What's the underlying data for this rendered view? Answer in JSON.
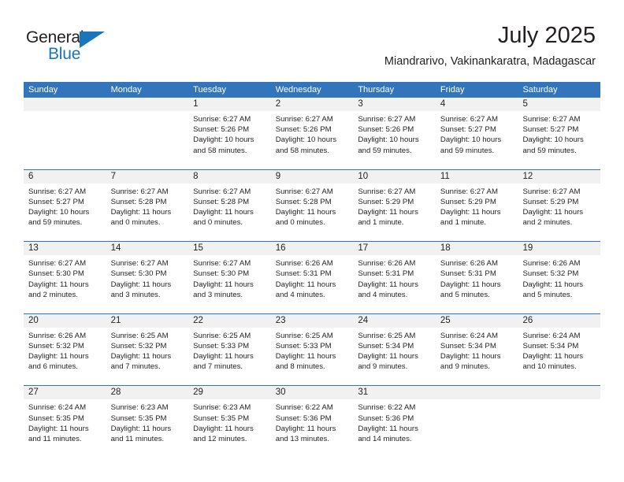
{
  "brand": {
    "name_top": "General",
    "name_bottom": "Blue",
    "color_blue": "#1b75bb",
    "color_dark": "#231f20"
  },
  "header": {
    "title": "July 2025",
    "subtitle": "Miandrarivo, Vakinankaratra, Madagascar"
  },
  "theme": {
    "header_blue": "#3275bc",
    "band_gray": "#f1f1f1",
    "text": "#231f20"
  },
  "weekdays": [
    "Sunday",
    "Monday",
    "Tuesday",
    "Wednesday",
    "Thursday",
    "Friday",
    "Saturday"
  ],
  "weeks": [
    [
      {
        "day": "",
        "sunrise": "",
        "sunset": "",
        "daylight1": "",
        "daylight2": "",
        "empty": true
      },
      {
        "day": "",
        "sunrise": "",
        "sunset": "",
        "daylight1": "",
        "daylight2": "",
        "empty": true
      },
      {
        "day": "1",
        "sunrise": "Sunrise: 6:27 AM",
        "sunset": "Sunset: 5:26 PM",
        "daylight1": "Daylight: 10 hours",
        "daylight2": "and 58 minutes."
      },
      {
        "day": "2",
        "sunrise": "Sunrise: 6:27 AM",
        "sunset": "Sunset: 5:26 PM",
        "daylight1": "Daylight: 10 hours",
        "daylight2": "and 58 minutes."
      },
      {
        "day": "3",
        "sunrise": "Sunrise: 6:27 AM",
        "sunset": "Sunset: 5:26 PM",
        "daylight1": "Daylight: 10 hours",
        "daylight2": "and 59 minutes."
      },
      {
        "day": "4",
        "sunrise": "Sunrise: 6:27 AM",
        "sunset": "Sunset: 5:27 PM",
        "daylight1": "Daylight: 10 hours",
        "daylight2": "and 59 minutes."
      },
      {
        "day": "5",
        "sunrise": "Sunrise: 6:27 AM",
        "sunset": "Sunset: 5:27 PM",
        "daylight1": "Daylight: 10 hours",
        "daylight2": "and 59 minutes."
      }
    ],
    [
      {
        "day": "6",
        "sunrise": "Sunrise: 6:27 AM",
        "sunset": "Sunset: 5:27 PM",
        "daylight1": "Daylight: 10 hours",
        "daylight2": "and 59 minutes."
      },
      {
        "day": "7",
        "sunrise": "Sunrise: 6:27 AM",
        "sunset": "Sunset: 5:28 PM",
        "daylight1": "Daylight: 11 hours",
        "daylight2": "and 0 minutes."
      },
      {
        "day": "8",
        "sunrise": "Sunrise: 6:27 AM",
        "sunset": "Sunset: 5:28 PM",
        "daylight1": "Daylight: 11 hours",
        "daylight2": "and 0 minutes."
      },
      {
        "day": "9",
        "sunrise": "Sunrise: 6:27 AM",
        "sunset": "Sunset: 5:28 PM",
        "daylight1": "Daylight: 11 hours",
        "daylight2": "and 0 minutes."
      },
      {
        "day": "10",
        "sunrise": "Sunrise: 6:27 AM",
        "sunset": "Sunset: 5:29 PM",
        "daylight1": "Daylight: 11 hours",
        "daylight2": "and 1 minute."
      },
      {
        "day": "11",
        "sunrise": "Sunrise: 6:27 AM",
        "sunset": "Sunset: 5:29 PM",
        "daylight1": "Daylight: 11 hours",
        "daylight2": "and 1 minute."
      },
      {
        "day": "12",
        "sunrise": "Sunrise: 6:27 AM",
        "sunset": "Sunset: 5:29 PM",
        "daylight1": "Daylight: 11 hours",
        "daylight2": "and 2 minutes."
      }
    ],
    [
      {
        "day": "13",
        "sunrise": "Sunrise: 6:27 AM",
        "sunset": "Sunset: 5:30 PM",
        "daylight1": "Daylight: 11 hours",
        "daylight2": "and 2 minutes."
      },
      {
        "day": "14",
        "sunrise": "Sunrise: 6:27 AM",
        "sunset": "Sunset: 5:30 PM",
        "daylight1": "Daylight: 11 hours",
        "daylight2": "and 3 minutes."
      },
      {
        "day": "15",
        "sunrise": "Sunrise: 6:27 AM",
        "sunset": "Sunset: 5:30 PM",
        "daylight1": "Daylight: 11 hours",
        "daylight2": "and 3 minutes."
      },
      {
        "day": "16",
        "sunrise": "Sunrise: 6:26 AM",
        "sunset": "Sunset: 5:31 PM",
        "daylight1": "Daylight: 11 hours",
        "daylight2": "and 4 minutes."
      },
      {
        "day": "17",
        "sunrise": "Sunrise: 6:26 AM",
        "sunset": "Sunset: 5:31 PM",
        "daylight1": "Daylight: 11 hours",
        "daylight2": "and 4 minutes."
      },
      {
        "day": "18",
        "sunrise": "Sunrise: 6:26 AM",
        "sunset": "Sunset: 5:31 PM",
        "daylight1": "Daylight: 11 hours",
        "daylight2": "and 5 minutes."
      },
      {
        "day": "19",
        "sunrise": "Sunrise: 6:26 AM",
        "sunset": "Sunset: 5:32 PM",
        "daylight1": "Daylight: 11 hours",
        "daylight2": "and 5 minutes."
      }
    ],
    [
      {
        "day": "20",
        "sunrise": "Sunrise: 6:26 AM",
        "sunset": "Sunset: 5:32 PM",
        "daylight1": "Daylight: 11 hours",
        "daylight2": "and 6 minutes."
      },
      {
        "day": "21",
        "sunrise": "Sunrise: 6:25 AM",
        "sunset": "Sunset: 5:32 PM",
        "daylight1": "Daylight: 11 hours",
        "daylight2": "and 7 minutes."
      },
      {
        "day": "22",
        "sunrise": "Sunrise: 6:25 AM",
        "sunset": "Sunset: 5:33 PM",
        "daylight1": "Daylight: 11 hours",
        "daylight2": "and 7 minutes."
      },
      {
        "day": "23",
        "sunrise": "Sunrise: 6:25 AM",
        "sunset": "Sunset: 5:33 PM",
        "daylight1": "Daylight: 11 hours",
        "daylight2": "and 8 minutes."
      },
      {
        "day": "24",
        "sunrise": "Sunrise: 6:25 AM",
        "sunset": "Sunset: 5:34 PM",
        "daylight1": "Daylight: 11 hours",
        "daylight2": "and 9 minutes."
      },
      {
        "day": "25",
        "sunrise": "Sunrise: 6:24 AM",
        "sunset": "Sunset: 5:34 PM",
        "daylight1": "Daylight: 11 hours",
        "daylight2": "and 9 minutes."
      },
      {
        "day": "26",
        "sunrise": "Sunrise: 6:24 AM",
        "sunset": "Sunset: 5:34 PM",
        "daylight1": "Daylight: 11 hours",
        "daylight2": "and 10 minutes."
      }
    ],
    [
      {
        "day": "27",
        "sunrise": "Sunrise: 6:24 AM",
        "sunset": "Sunset: 5:35 PM",
        "daylight1": "Daylight: 11 hours",
        "daylight2": "and 11 minutes."
      },
      {
        "day": "28",
        "sunrise": "Sunrise: 6:23 AM",
        "sunset": "Sunset: 5:35 PM",
        "daylight1": "Daylight: 11 hours",
        "daylight2": "and 11 minutes."
      },
      {
        "day": "29",
        "sunrise": "Sunrise: 6:23 AM",
        "sunset": "Sunset: 5:35 PM",
        "daylight1": "Daylight: 11 hours",
        "daylight2": "and 12 minutes."
      },
      {
        "day": "30",
        "sunrise": "Sunrise: 6:22 AM",
        "sunset": "Sunset: 5:36 PM",
        "daylight1": "Daylight: 11 hours",
        "daylight2": "and 13 minutes."
      },
      {
        "day": "31",
        "sunrise": "Sunrise: 6:22 AM",
        "sunset": "Sunset: 5:36 PM",
        "daylight1": "Daylight: 11 hours",
        "daylight2": "and 14 minutes."
      },
      {
        "day": "",
        "sunrise": "",
        "sunset": "",
        "daylight1": "",
        "daylight2": "",
        "empty": true
      },
      {
        "day": "",
        "sunrise": "",
        "sunset": "",
        "daylight1": "",
        "daylight2": "",
        "empty": true
      }
    ]
  ]
}
